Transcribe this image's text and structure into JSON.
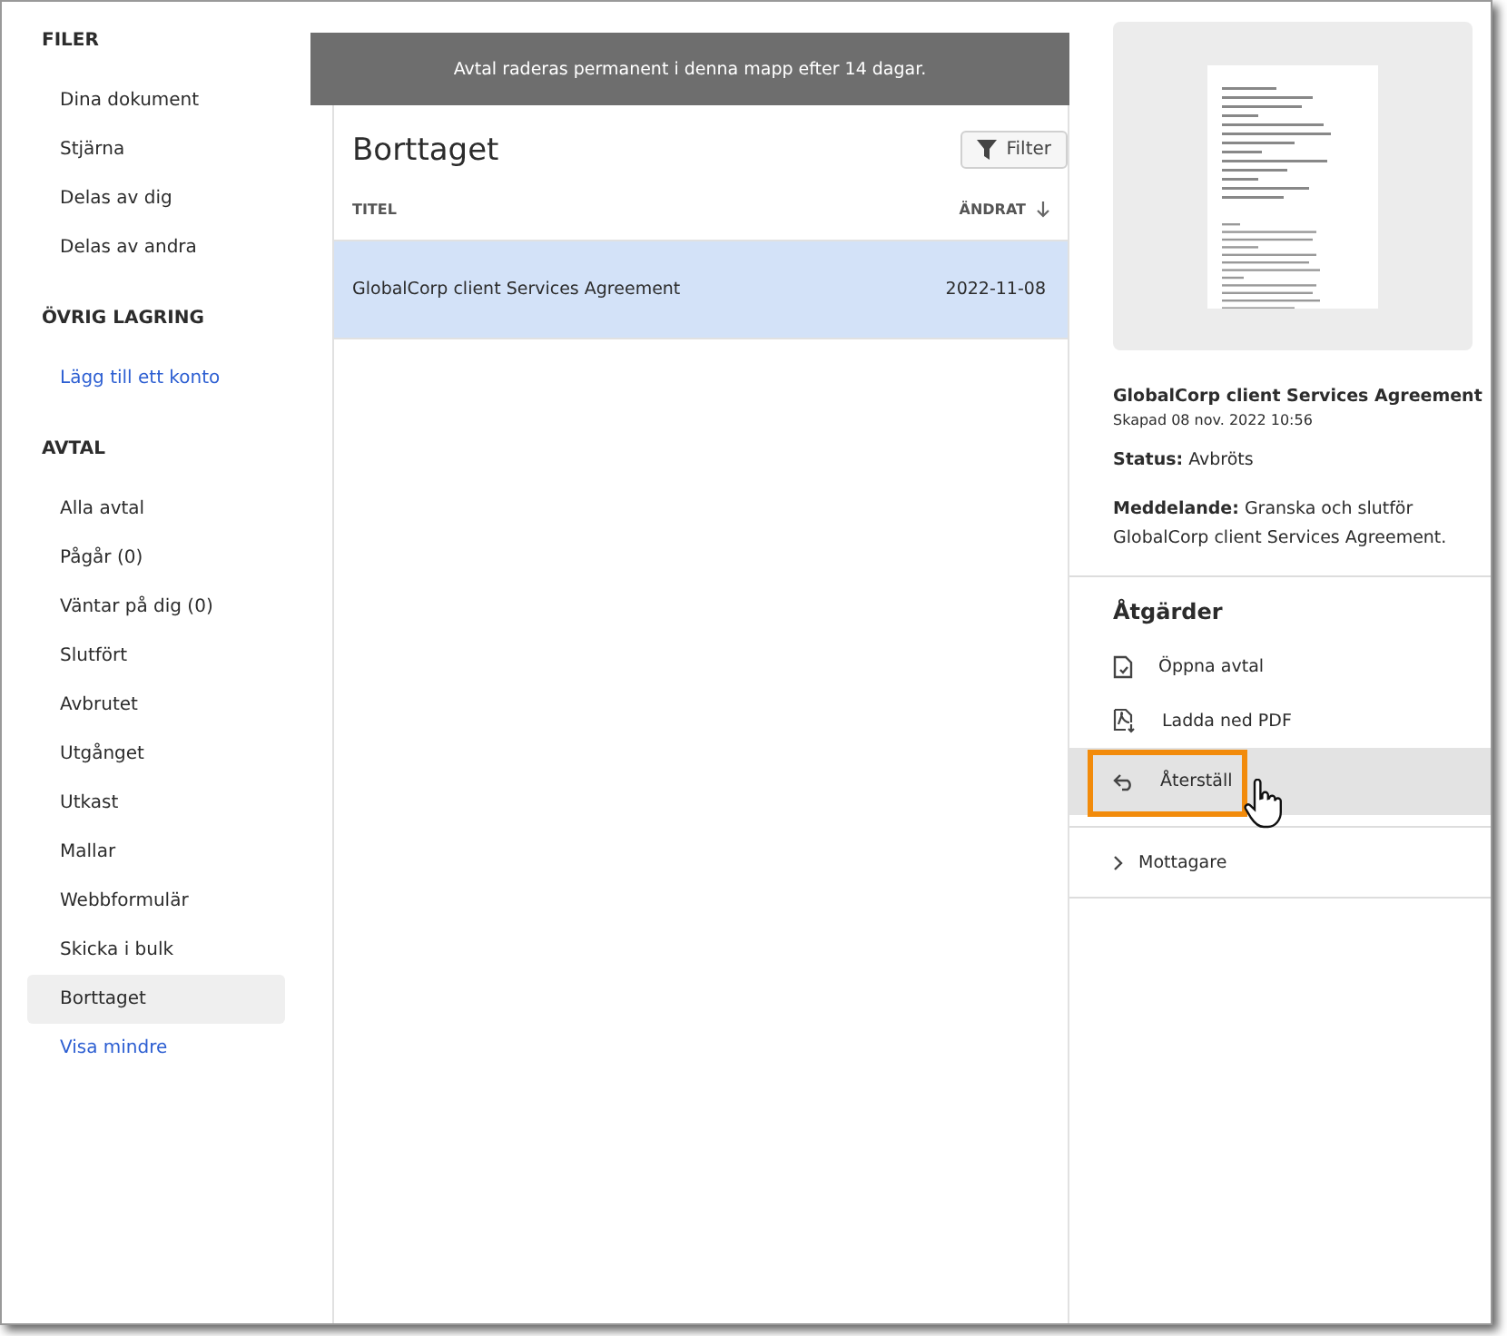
{
  "sidebar": {
    "sections": [
      {
        "heading": "FILER",
        "items": [
          {
            "label": "Dina dokument",
            "kind": "item",
            "selected": false
          },
          {
            "label": "Stjärna",
            "kind": "item",
            "selected": false
          },
          {
            "label": "Delas av dig",
            "kind": "item",
            "selected": false
          },
          {
            "label": "Delas av andra",
            "kind": "item",
            "selected": false
          }
        ]
      },
      {
        "heading": "ÖVRIG LAGRING",
        "items": [
          {
            "label": "Lägg till ett konto",
            "kind": "link",
            "selected": false
          }
        ]
      },
      {
        "heading": "AVTAL",
        "items": [
          {
            "label": "Alla avtal",
            "kind": "item",
            "selected": false
          },
          {
            "label": "Pågår (0)",
            "kind": "item",
            "selected": false
          },
          {
            "label": "Väntar på dig (0)",
            "kind": "item",
            "selected": false
          },
          {
            "label": "Slutfört",
            "kind": "item",
            "selected": false
          },
          {
            "label": "Avbrutet",
            "kind": "item",
            "selected": false
          },
          {
            "label": "Utgånget",
            "kind": "item",
            "selected": false
          },
          {
            "label": "Utkast",
            "kind": "item",
            "selected": false
          },
          {
            "label": "Mallar",
            "kind": "item",
            "selected": false
          },
          {
            "label": "Webbformulär",
            "kind": "item",
            "selected": false
          },
          {
            "label": "Skicka i bulk",
            "kind": "item",
            "selected": false
          },
          {
            "label": "Borttaget",
            "kind": "item",
            "selected": true
          },
          {
            "label": "Visa mindre",
            "kind": "link",
            "selected": false
          }
        ]
      }
    ]
  },
  "banner": {
    "text": "Avtal raderas permanent i denna mapp efter 14 dagar."
  },
  "list": {
    "title": "Borttaget",
    "filter_button": "Filter",
    "columns": [
      {
        "label": "TITEL",
        "sorted": false
      },
      {
        "label": "ÄNDRAT",
        "sorted": true
      }
    ],
    "rows": [
      {
        "title": "GlobalCorp client Services Agreement",
        "modified": "2022-11-08",
        "selected": true
      }
    ]
  },
  "details": {
    "title": "GlobalCorp client Services Agreement",
    "created": "Skapad 08 nov. 2022 10:56",
    "status": "**Status:** Avbröts",
    "message": "**Meddelande:**  Granska och slutför GlobalCorp client Services Agreement.",
    "actions_heading": "Åtgärder",
    "actions": [
      {
        "label": "Öppna avtal",
        "kind": "open",
        "highlighted": false
      },
      {
        "label": "Ladda ned PDF",
        "kind": "download",
        "highlighted": false
      },
      {
        "label": "Återställ",
        "kind": "restore",
        "highlighted": true
      }
    ],
    "recipients": {
      "label": "Mottagare",
      "expanded": false
    }
  }
}
